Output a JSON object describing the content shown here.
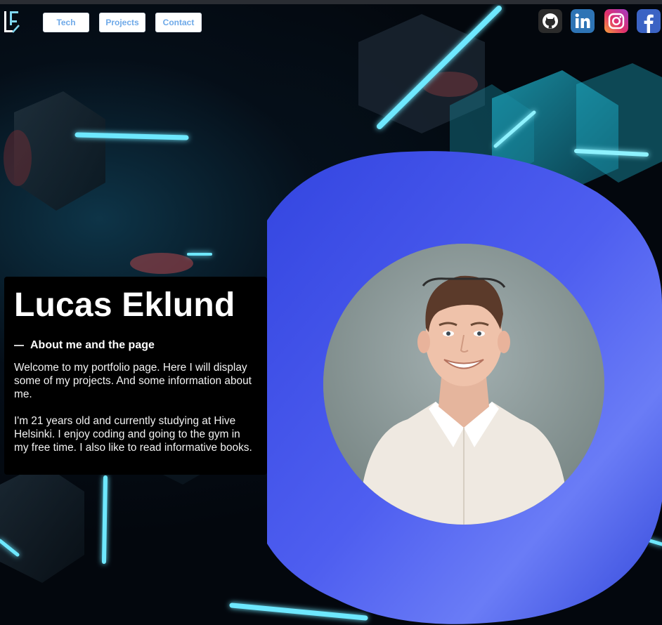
{
  "nav": {
    "logo_text": "LE",
    "items": [
      {
        "label": "Tech"
      },
      {
        "label": "Projects"
      },
      {
        "label": "Contact"
      }
    ]
  },
  "social": [
    {
      "name": "github",
      "icon": "github-icon",
      "color": "#1f1f1f"
    },
    {
      "name": "linkedin",
      "icon": "linkedin-icon",
      "color": "#2e74b5"
    },
    {
      "name": "instagram",
      "icon": "instagram-icon",
      "color": "#e1306c"
    },
    {
      "name": "facebook",
      "icon": "facebook-icon",
      "color": "#3b63c4"
    }
  ],
  "intro": {
    "name": "Lucas Eklund",
    "subheading": "About me and the page",
    "paragraph1": "Welcome to my portfolio page. Here I will display some of my projects. And some information about me.",
    "paragraph2": "I'm 21 years old and currently studying at Hive Helsinki. I enjoy coding and going to the gym in my free time. I also like to read informative books."
  },
  "colors": {
    "blob_accent": "#3d52e0",
    "nav_text": "#6ea9e8",
    "card_bg": "#000000"
  }
}
